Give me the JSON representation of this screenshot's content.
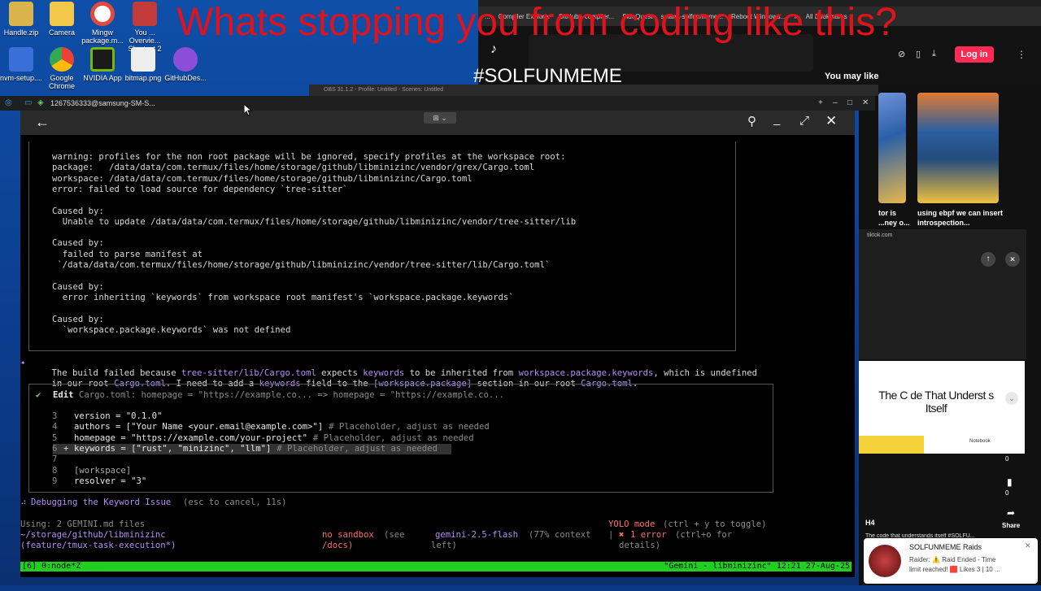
{
  "meme": {
    "headline": "Whats stopping you from coding like this?",
    "hashtag": "#SOLFUNMEME"
  },
  "desktop_icons": [
    {
      "label": "Handle.zip",
      "color": "#d9b44a"
    },
    {
      "label": "Camera",
      "color": "#f2c84b"
    },
    {
      "label": "Mingw package.m...",
      "color": "#e34a3b"
    },
    {
      "label": "You ... Overvie... Shortcut 2",
      "color": "#c23b3b"
    },
    {
      "label": "nvm-setup....",
      "color": "#3a6fd8"
    },
    {
      "label": "Google Chrome",
      "color": "#ffffff"
    },
    {
      "label": "NVIDIA App",
      "color": "#76b900"
    },
    {
      "label": "bitmap.png",
      "color": "#dddddd"
    },
    {
      "label": "GitHubDes...",
      "color": "#8a4fd6"
    }
  ],
  "browser": {
    "bookmarks": [
      "...",
      "Compiler Explorer",
      "GitHub - compiler...",
      "SideQuest",
      "solana-solfunmeme...",
      "Reboot Windows...",
      "»",
      "All Bookmarks"
    ],
    "login_label": "Log in",
    "you_may_like": "You may like",
    "suggested": [
      {
        "caption": "tor is ...ney o..."
      },
      {
        "caption": "using ebpf we can insert introspection..."
      }
    ],
    "tiktok_domain": "tiktok.com"
  },
  "obs": {
    "title": "OBS 31.1.2 - Profile: Untitled - Scenes: Untitled"
  },
  "terminal_window": {
    "title": "1267536333@samsung-SM-S..."
  },
  "terminal": {
    "error_block": [
      "warning: profiles for the non root package will be ignored, specify profiles at the workspace root:",
      "package:   /data/data/com.termux/files/home/storage/github/libminizinc/vendor/grex/Cargo.toml",
      "workspace: /data/data/com.termux/files/home/storage/github/libminizinc/Cargo.toml",
      "error: failed to load source for dependency `tree-sitter`",
      "",
      "Caused by:",
      "  Unable to update /data/data/com.termux/files/home/storage/github/libminizinc/vendor/tree-sitter/lib",
      "",
      "Caused by:",
      "  failed to parse manifest at",
      " `/data/data/com.termux/files/home/storage/github/libminizinc/vendor/tree-sitter/lib/Cargo.toml`",
      "",
      "Caused by:",
      "  error inheriting `keywords` from workspace root manifest's `workspace.package.keywords`",
      "",
      "Caused by:",
      "  `workspace.package.keywords` was not defined"
    ],
    "assistant_line1_parts": [
      "The build failed because ",
      "tree-sitter/lib/Cargo.toml",
      " expects ",
      "keywords",
      " to be inherited from ",
      "workspace.package.keywords",
      ", which is undefined"
    ],
    "assistant_line2_parts": [
      "in our root ",
      "Cargo.toml",
      ". I need to add a ",
      "keywords",
      " field to the ",
      "[workspace.package]",
      " section in our root ",
      "Cargo.toml",
      "."
    ],
    "edit": {
      "check": "✔",
      "label": "Edit",
      "summary": "Cargo.toml: homepage = \"https://example.co... => homepage = \"https://example.co...",
      "lines": [
        {
          "num": "3",
          "code": "version = \"0.1.0\"",
          "comment": ""
        },
        {
          "num": "4",
          "code": "authors = [\"Your Name <your.email@example.com>\"]",
          "comment": " # Placeholder, adjust as needed"
        },
        {
          "num": "5",
          "code": "homepage = \"https://example.com/your-project\"",
          "comment": " # Placeholder, adjust as needed"
        },
        {
          "num": "6",
          "code": "keywords = [\"rust\", \"minizinc\", \"llm\"]",
          "comment": " # Placeholder, adjust as needed",
          "added": true
        },
        {
          "num": "7",
          "code": "",
          "comment": ""
        },
        {
          "num": "8",
          "code": "[workspace]",
          "comment": ""
        },
        {
          "num": "9",
          "code": "resolver = \"3\"",
          "comment": ""
        }
      ]
    },
    "thinking": {
      "spinner": "⠴",
      "text": "Debugging the Keyword Issue",
      "hint": "(esc to cancel, 11s)"
    },
    "footer": {
      "using": "Using: 2 GEMINI.md files",
      "path": "~/storage/github/libminizinc",
      "branch": "(feature/tmux-task-execution*)",
      "sandbox1": "no sandbox",
      "sandbox_see": "(see",
      "sandbox2": "/docs)",
      "model": "gemini-2.5-flash",
      "context1": "(77% context",
      "context2": "left)",
      "yolo": "YOLO mode",
      "yolo_hint": "(ctrl + y to toggle)",
      "errors_pipe": "|",
      "errors_x": "✖",
      "errors": "1 error",
      "errors_hint": "(ctrl+o for",
      "errors_hint2": "details)"
    },
    "tmux_status_left": "[6] 0:node*Z",
    "tmux_status_right": "\"Gemini - libminizinc\" 12:21 27-Aug-25"
  },
  "video_panel": {
    "card_title": "The C  de That Underst    s Itself",
    "card_sub": "Notebook",
    "likes": "0",
    "saves": "0",
    "share_label": "Share",
    "h4": "H4",
    "caption": "The code that understands itself #SOLFU..."
  },
  "notification": {
    "title": "SOLFUNMEME Raids",
    "line1": "Raider: ⚠️ Raid Ended - Time",
    "line2": "limit reached! 🟥 Likes 3 | 10 ..."
  },
  "colors": {
    "meme_red": "#e0131c",
    "tmux_green": "#20d020",
    "tiktok_pink": "#fe2c55",
    "accent_purple": "#b58cf7"
  }
}
